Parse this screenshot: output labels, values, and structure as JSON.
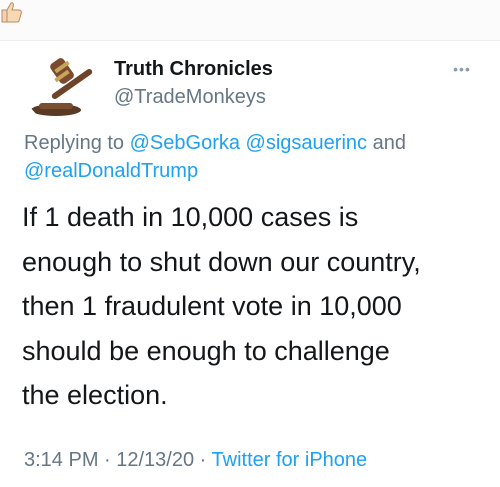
{
  "header": {
    "like_icon": "thumbs-up-icon"
  },
  "tweet": {
    "display_name": "Truth Chronicles",
    "handle": "@TradeMonkeys",
    "avatar_icon": "gavel-avatar",
    "more_icon": "more-options-icon",
    "reply": {
      "prefix": "Replying to",
      "mention_1": "@SebGorka",
      "mention_2": "@sigsauerinc",
      "conjunction": "and",
      "mention_3": "@realDonaldTrump"
    },
    "text_lines": [
      "If 1 death in 10,000 cases is",
      "enough to shut down our country,",
      "then 1 fraudulent vote in 10,000",
      "should be enough to challenge",
      "the election."
    ],
    "time": "3:14 PM · 12/13/20",
    "separator": "·",
    "source": "Twitter for iPhone"
  },
  "colors": {
    "link": "#1da1f2",
    "secondary_text": "#657786",
    "primary_text": "#14171a"
  }
}
